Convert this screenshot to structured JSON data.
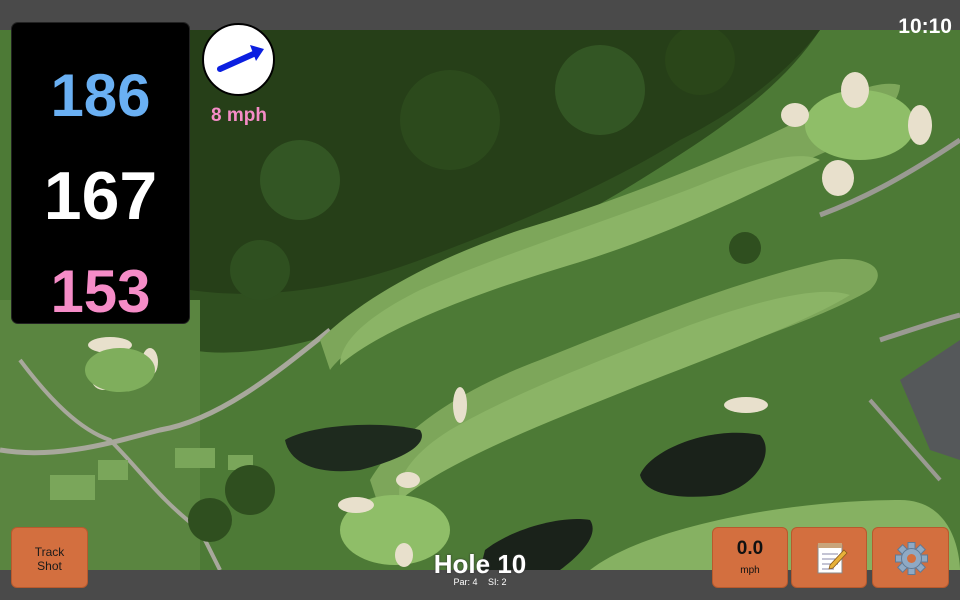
{
  "status_bar": {
    "time": "10:10"
  },
  "yardages": {
    "back": "186",
    "center": "167",
    "front": "153"
  },
  "wind": {
    "speed": "8 mph",
    "direction_icon": "arrow-icon"
  },
  "hole": {
    "title": "Hole 10",
    "par": "Par: 4",
    "stroke_index": "SI: 2"
  },
  "buttons": {
    "track_shot_line1": "Track",
    "track_shot_line2": "Shot",
    "speed_value": "0.0",
    "speed_unit": "mph",
    "notes_icon": "notepad-icon",
    "settings_icon": "gear-icon"
  },
  "colors": {
    "back_yardage": "#6ab0f3",
    "center_yardage": "#ffffff",
    "front_yardage": "#f58cc7",
    "button": "#d36f3f",
    "wind_arrow": "#0b1fe0"
  }
}
